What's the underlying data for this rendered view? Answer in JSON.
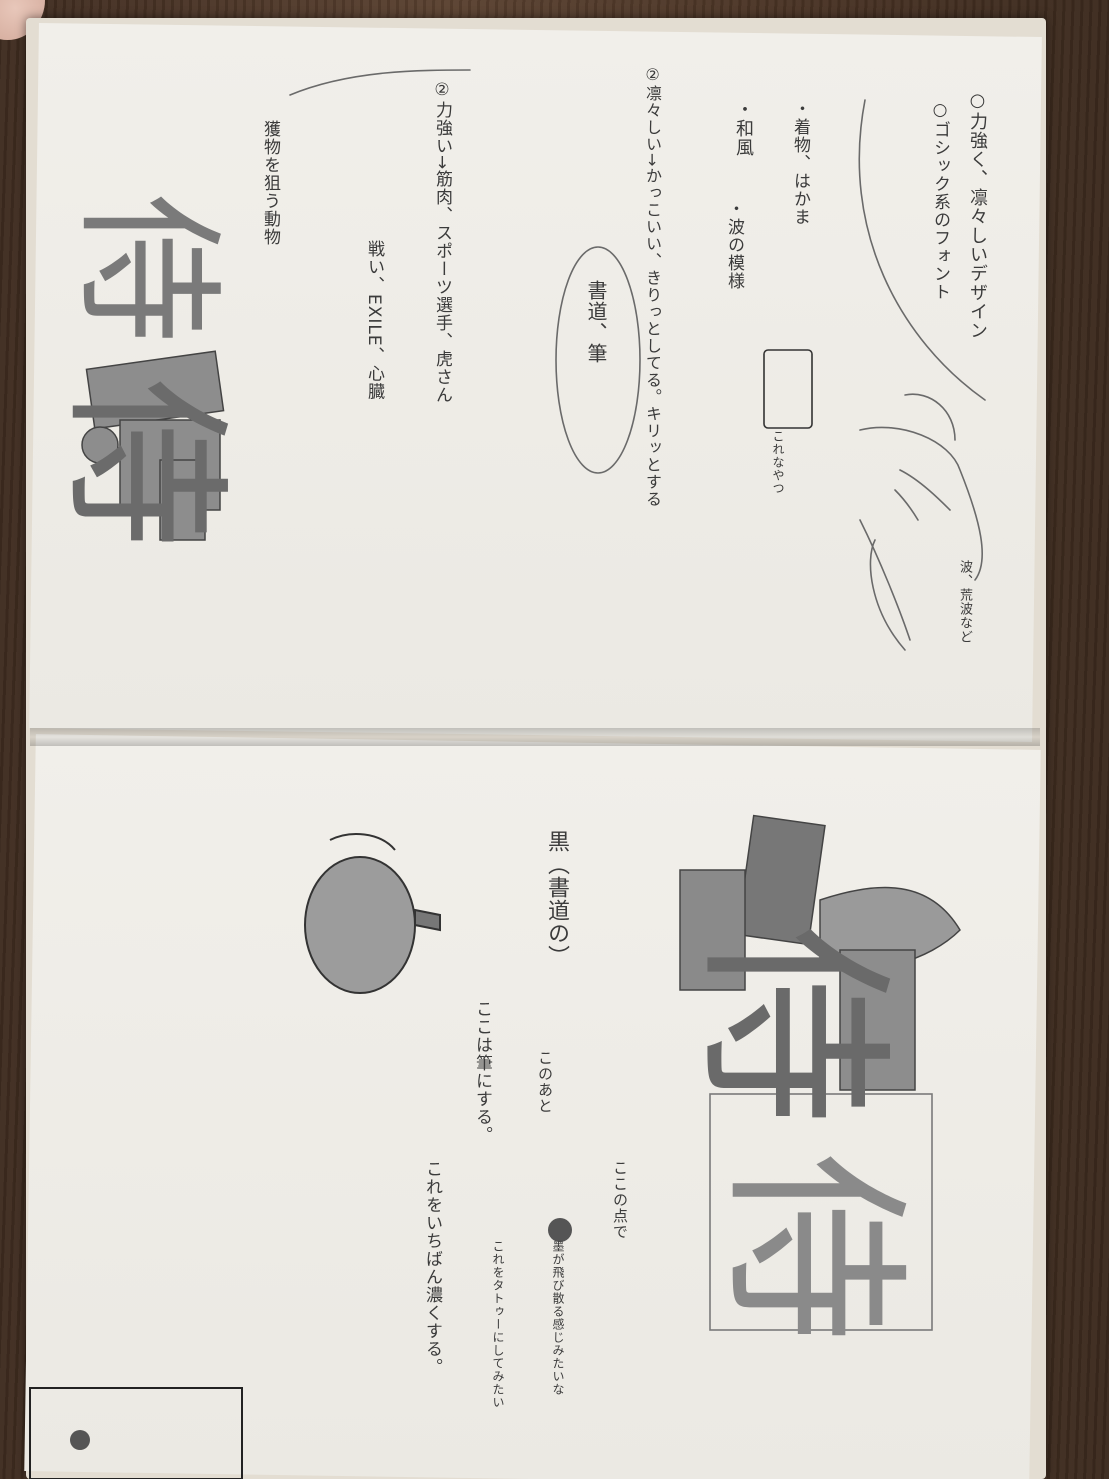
{
  "colors": {
    "paper": "#efece6",
    "pencil": "#3b3b3b",
    "pencil_light": "#8a8a8a",
    "table": "#4a3526"
  },
  "left_page": {
    "notes": [
      "○力強く、凛々しいデザイン",
      "○ゴシック系のフォント",
      "・着物、はかま",
      "・波の模様",
      "これなやつ",
      "・和風",
      "波、荒波など",
      "②凛々しい→かっこいい、きりっとしてる。キリッとする",
      "書道、筆",
      "②力強い→筋肉、スポーツ選手、虎さん",
      "戦い、EXILE、心臓",
      "獲物を狙う動物"
    ],
    "large_characters": [
      "侍",
      "侍"
    ]
  },
  "right_page": {
    "notes": [
      "黒（書道の）",
      "ここは筆にする。",
      "このあと",
      "ここの点で",
      "これをいちばん濃くする。",
      "これをタトゥーにしてみたい",
      "墨が飛び散る感じみたいな"
    ],
    "large_characters": [
      "侍",
      "侍"
    ]
  }
}
